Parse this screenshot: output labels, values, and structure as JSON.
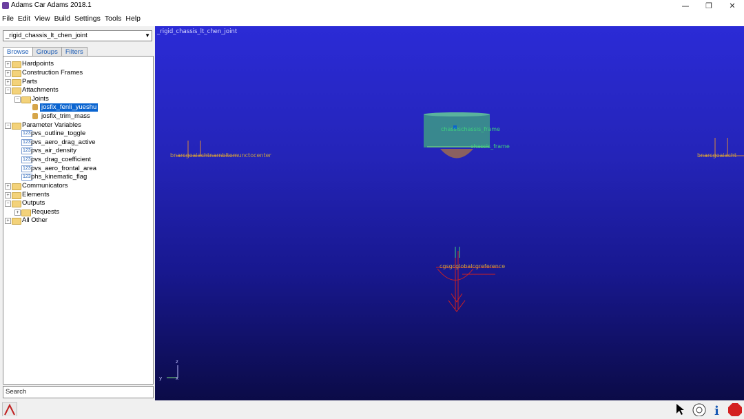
{
  "window": {
    "title": "Adams Car Adams 2018.1",
    "minimize": "—",
    "restore": "❐",
    "close": "✕"
  },
  "menu": [
    "File",
    "Edit",
    "View",
    "Build",
    "Settings",
    "Tools",
    "Help"
  ],
  "left_panel": {
    "combo_value": "_rigid_chassis_lt_chen_joint",
    "tabs": [
      "Browse",
      "Groups",
      "Filters"
    ],
    "tree": [
      {
        "label": "Hardpoints"
      },
      {
        "label": "Construction Frames"
      },
      {
        "label": "Parts"
      },
      {
        "label": "Attachments"
      },
      {
        "label": "Joints"
      },
      {
        "label": "josfix_fenli_yueshu"
      },
      {
        "label": "josfix_trim_mass"
      },
      {
        "label": "Parameter Variables"
      },
      {
        "label": "pvs_outline_toggle"
      },
      {
        "label": "pvs_aero_drag_active"
      },
      {
        "label": "pvs_air_density"
      },
      {
        "label": "pvs_drag_coefficient"
      },
      {
        "label": "pvs_aero_frontal_area"
      },
      {
        "label": "phs_kinematic_flag"
      },
      {
        "label": "Communicators"
      },
      {
        "label": "Elements"
      },
      {
        "label": "Outputs"
      },
      {
        "label": "Requests"
      },
      {
        "label": "All Other"
      }
    ],
    "var_tag": "123",
    "search_label": "Search"
  },
  "viewport": {
    "title": "_rigid_chassis_lt_chen_joint",
    "label_left": "bnarcgoaiachtnarnbltemunctocenter",
    "label_top1": "chassischassis_frame",
    "label_top2": "chassis_frame",
    "label_right": "bnarcgoaiacht",
    "label_bottom": "cgsgcglobalcgreference",
    "axis_z": "z",
    "axis_y": "y",
    "axis_x": "x"
  },
  "colors": {
    "viewport_top": "#2b2bd6",
    "viewport_bottom": "#0b0b47",
    "selection": "#0a64d0"
  }
}
